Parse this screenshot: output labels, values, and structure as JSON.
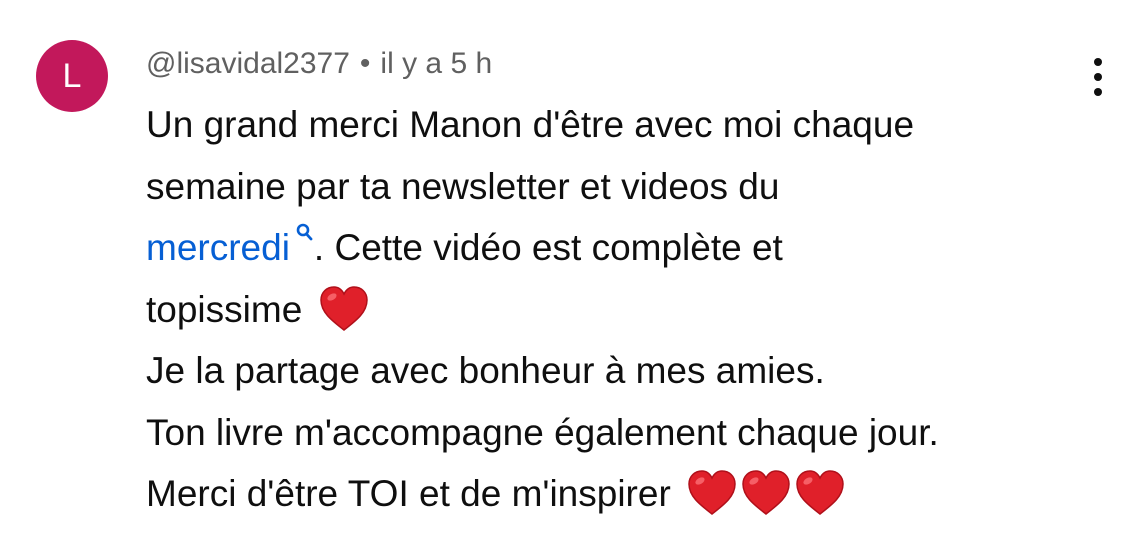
{
  "comment": {
    "avatar_letter": "L",
    "avatar_color": "#c2185b",
    "author": "@lisavidal2377",
    "separator": "•",
    "timestamp": "il y a 5 h",
    "menu_icon": "more-vert-icon",
    "link_color": "#065fd4",
    "lines": {
      "l1": "Un grand merci Manon d'être avec moi chaque",
      "l2": "semaine par ta newsletter et videos du",
      "l3_link": "mercredi",
      "l3_rest": ". Cette vidéo est complète et",
      "l4": "topissime",
      "l5": "Je la partage avec bonheur à mes amies.",
      "l6": "Ton livre m'accompagne également chaque jour.",
      "l7": "Merci d'être TOI et de m'inspirer"
    },
    "emoji": "red-heart-icon"
  }
}
